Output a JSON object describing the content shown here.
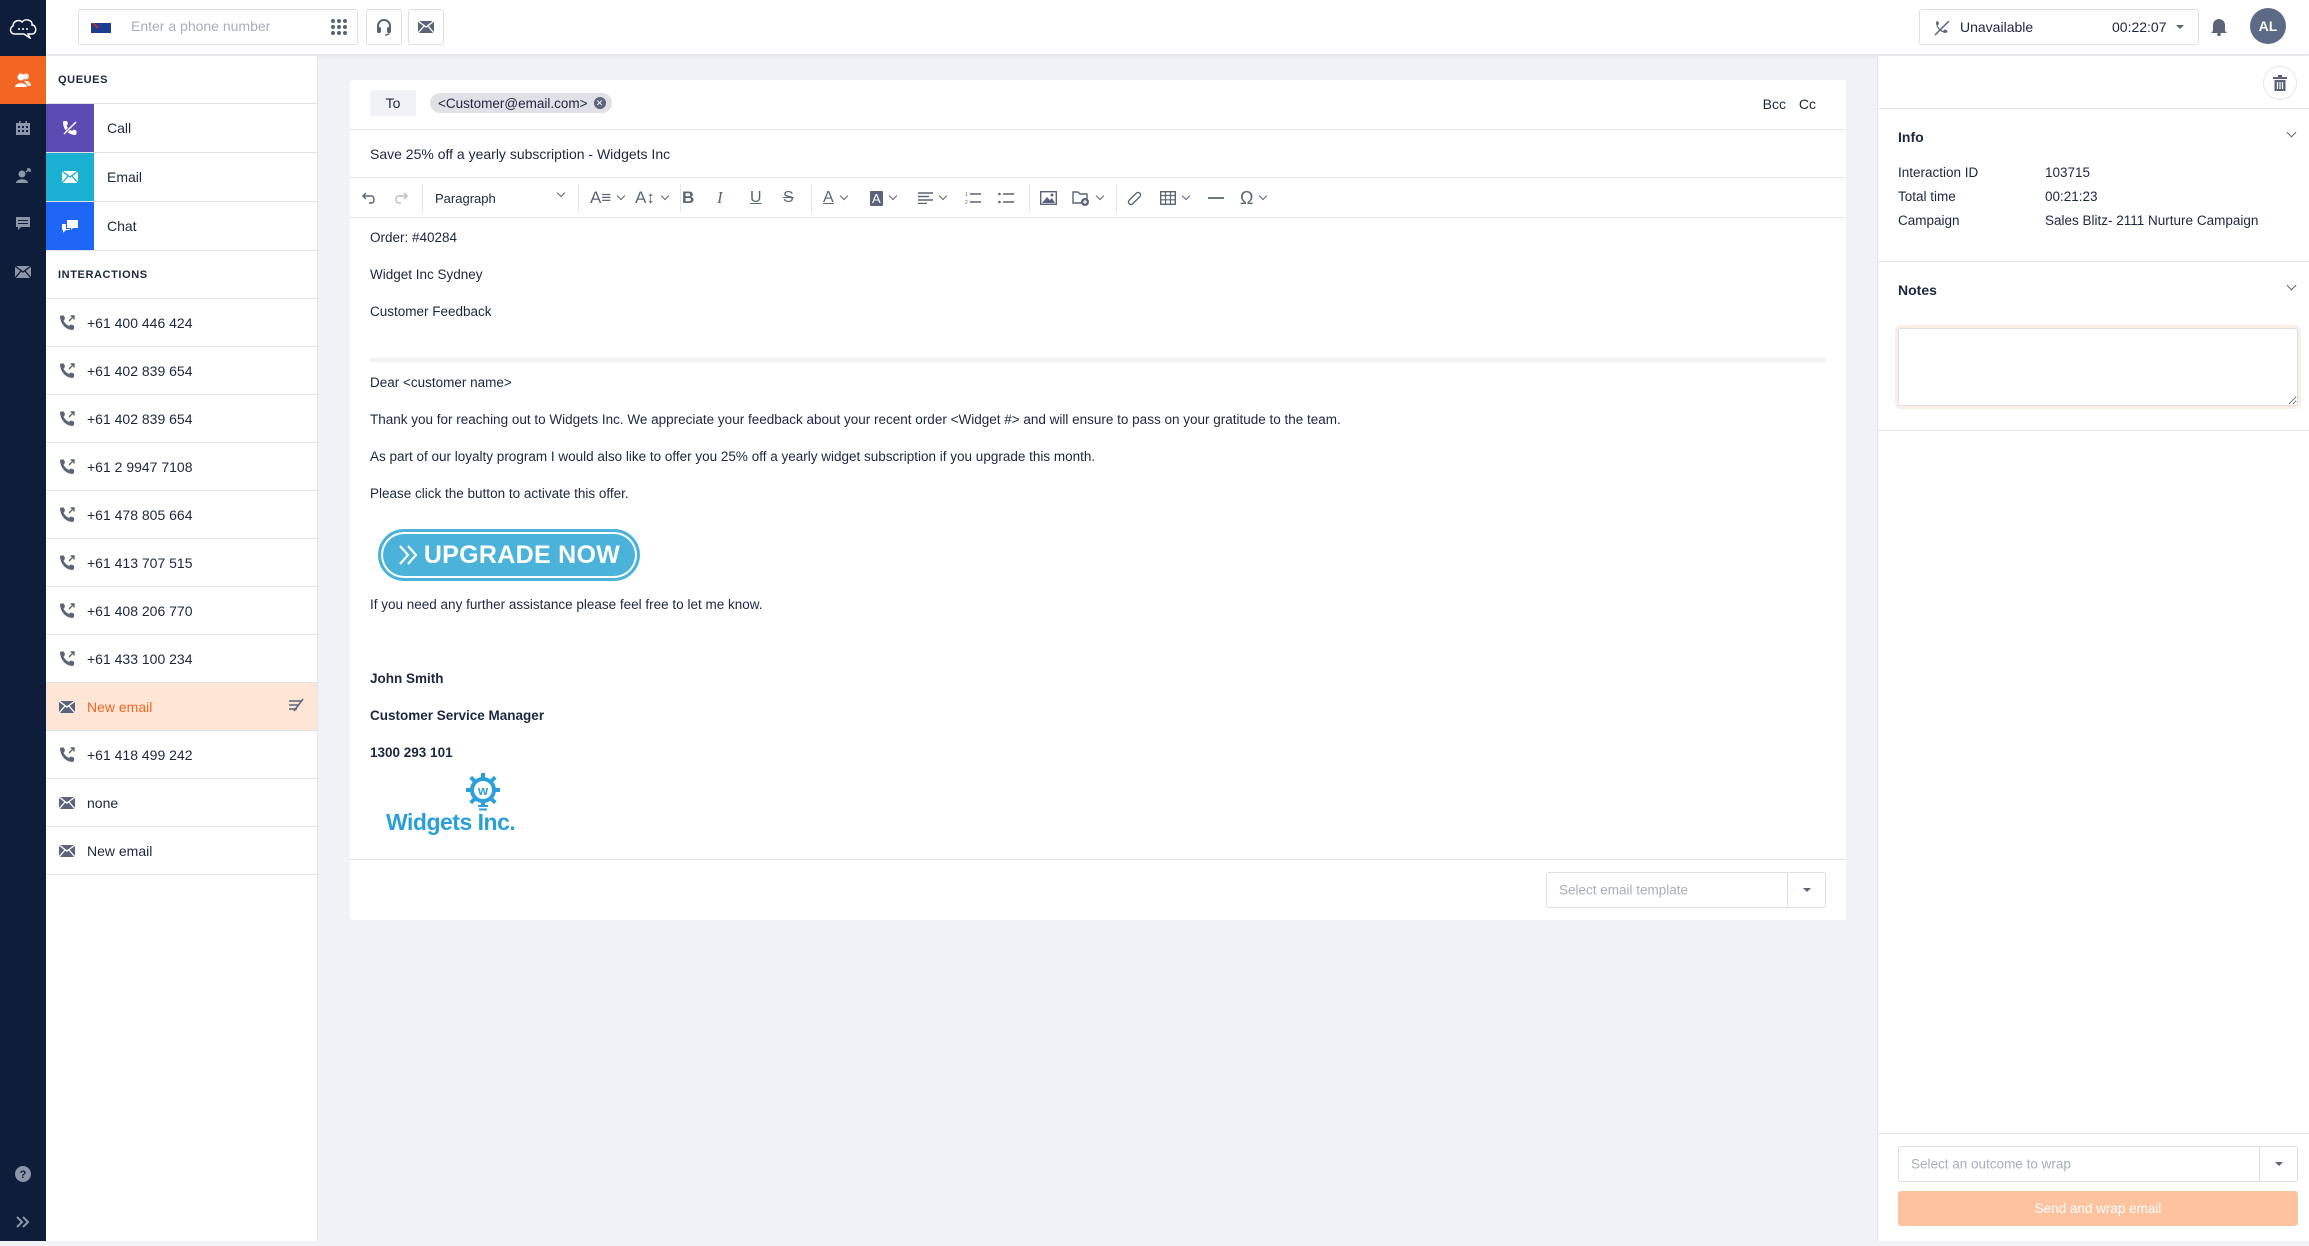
{
  "topbar": {
    "phone_placeholder": "Enter a phone number",
    "status": "Unavailable",
    "status_timer": "00:22:07",
    "avatar_initials": "AL"
  },
  "rail": {
    "items": [
      "queues-icon",
      "calendar-icon",
      "contacts-icon",
      "chat-icon",
      "email-icon"
    ],
    "bottom": [
      "help-icon",
      "expand-icon"
    ]
  },
  "left_panel": {
    "queues_heading": "QUEUES",
    "queues": [
      {
        "label": "Call",
        "color": "#5b4bb2"
      },
      {
        "label": "Email",
        "color": "#1ab0d2"
      },
      {
        "label": "Chat",
        "color": "#1e66f5"
      }
    ],
    "interactions_heading": "INTERACTIONS",
    "interactions": [
      {
        "type": "call",
        "label": "+61 400 446 424"
      },
      {
        "type": "call",
        "label": "+61 402 839 654"
      },
      {
        "type": "call",
        "label": "+61 402 839 654"
      },
      {
        "type": "call",
        "label": "+61 2 9947 7108"
      },
      {
        "type": "call",
        "label": "+61 478 805 664"
      },
      {
        "type": "call",
        "label": "+61 413 707 515"
      },
      {
        "type": "call",
        "label": "+61 408 206 770"
      },
      {
        "type": "call",
        "label": "+61 433 100 234"
      },
      {
        "type": "email",
        "label": "New email",
        "active": true
      },
      {
        "type": "call",
        "label": "+61 418 499 242"
      },
      {
        "type": "email",
        "label": "none"
      },
      {
        "type": "email",
        "label": "New email"
      }
    ]
  },
  "composer": {
    "to_label": "To",
    "recipient": "<Customer@email.com>",
    "bcc_label": "Bcc",
    "cc_label": "Cc",
    "subject": "Save 25% off a yearly subscription - Widgets Inc",
    "toolbar": {
      "block_format": "Paragraph"
    },
    "body": {
      "order": "Order: #40284",
      "location": "Widget Inc Sydney",
      "topic": "Customer Feedback",
      "greeting": "Dear <customer name>",
      "para1": "Thank you for reaching out to Widgets Inc. We appreciate your feedback about your  recent order <Widget #> and will ensure to pass on your gratitude to the team.",
      "para2": "As part of our loyalty program I would also like to offer you 25% off a yearly widget subscription if you upgrade this month.",
      "para3": "Please click the button to activate this offer.",
      "cta": "UPGRADE NOW",
      "para4": "If you need any further assistance please feel free to let me know.",
      "sig_name": "John Smith",
      "sig_title": "Customer Service Manager",
      "sig_phone": "1300 293 101",
      "logo_text": "Widgets Inc."
    },
    "template_placeholder": "Select email template"
  },
  "right_panel": {
    "info_heading": "Info",
    "info": [
      {
        "key": "Interaction ID",
        "value": "103715"
      },
      {
        "key": "Total time",
        "value": "00:21:23"
      },
      {
        "key": "Campaign",
        "value": "Sales Blitz- 2111 Nurture Campaign"
      }
    ],
    "notes_heading": "Notes",
    "outcome_placeholder": "Select an outcome to wrap",
    "wrap_button": "Send and wrap email"
  },
  "colors": {
    "accent": "#f26522",
    "rail": "#0e1d3a",
    "active_row": "#fde6d6",
    "wrap_button_disabled": "#fcc39e",
    "cta": "#4bb2da"
  }
}
